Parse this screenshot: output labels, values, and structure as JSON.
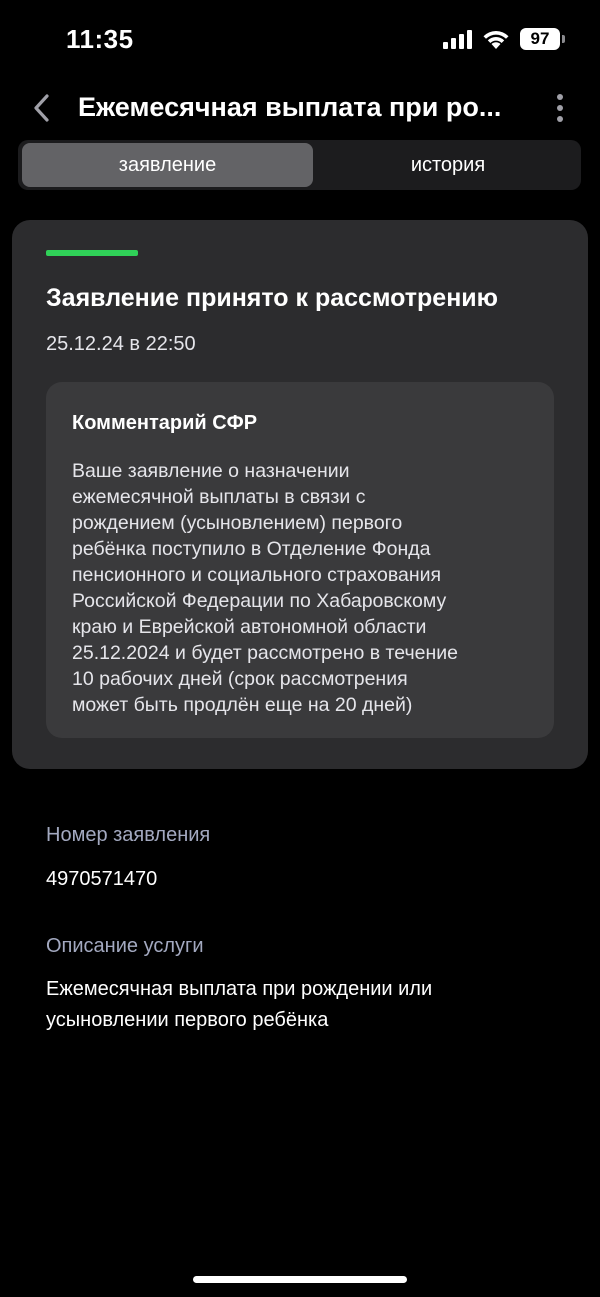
{
  "status_bar": {
    "time": "11:35",
    "battery": "97",
    "icons": [
      "signal-icon",
      "wifi-icon",
      "battery-icon"
    ]
  },
  "header": {
    "title": "Ежемесячная выплата при ро...",
    "back_icon": "chevron-left-icon",
    "menu_icon": "more-vertical-icon"
  },
  "tabs": [
    {
      "label": "заявление",
      "active": true
    },
    {
      "label": "история",
      "active": false
    }
  ],
  "status_card": {
    "title": "Заявление принято к рассмотрению",
    "date": "25.12.24 в 22:50",
    "accent_color": "#30d158",
    "comment": {
      "title": "Комментарий СФР",
      "lines": [
        "Ваше заявление о назначении",
        "ежемесячной выплаты в связи с",
        "рождением (усыновлением) первого",
        "ребёнка поступило в Отделение Фонда",
        "пенсионного и социального страхования",
        "Российской Федерации по Хабаровскому",
        "краю и Еврейской автономной области",
        "25.12.2024 и будет рассмотрено в течение",
        "10 рабочих дней (срок рассмотрения",
        "может быть продлён еще на 20 дней)"
      ]
    }
  },
  "application_number": {
    "label": "Номер заявления",
    "value": "4970571470"
  },
  "service_description": {
    "label": "Описание услуги",
    "lines": [
      "Ежемесячная выплата при рождении или",
      "усыновлении первого ребёнка"
    ]
  },
  "colors": {
    "background": "#000000",
    "card": "#2c2c2e",
    "comment_box": "#3a3a3c",
    "label": "#a3a9c0",
    "accent": "#30d158"
  }
}
